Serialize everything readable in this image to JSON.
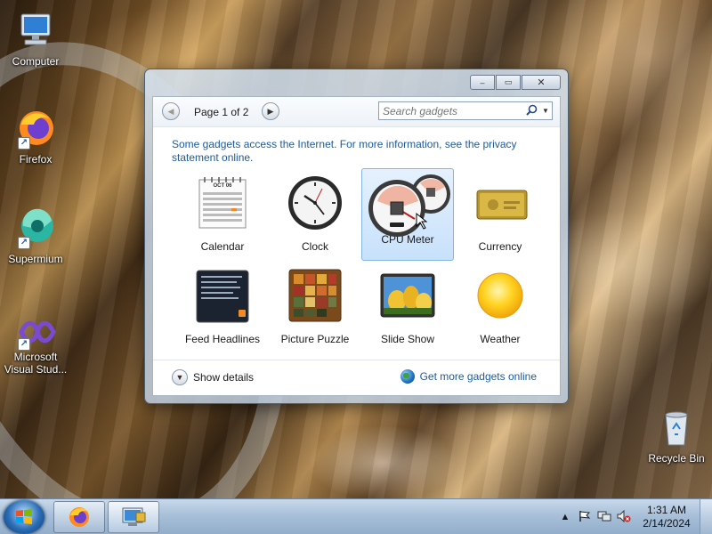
{
  "desktop": {
    "icons": [
      {
        "label": "Computer",
        "icon": "computer-icon"
      },
      {
        "label": "Firefox",
        "icon": "firefox-icon"
      },
      {
        "label": "Supermium",
        "icon": "supermium-icon"
      },
      {
        "label": "Microsoft Visual Stud...",
        "icon": "visual-studio-icon"
      },
      {
        "label": "Recycle Bin",
        "icon": "recycle-bin-icon"
      }
    ]
  },
  "gadget_window": {
    "controls": {
      "minimize": "‒",
      "restore": "▭",
      "close": "✕"
    },
    "nav": {
      "prev": "◀",
      "next": "▶",
      "page_label": "Page 1 of 2"
    },
    "search": {
      "placeholder": "Search gadgets",
      "icon": "search-icon",
      "dropdown": "▼"
    },
    "info_text": "Some gadgets access the Internet.  For more information, see the privacy statement online.",
    "gadgets": [
      {
        "name": "Calendar",
        "icon": "calendar-icon",
        "month": "OCT 06",
        "selected": false
      },
      {
        "name": "Clock",
        "icon": "clock-icon",
        "selected": false
      },
      {
        "name": "CPU Meter",
        "icon": "cpu-meter-icon",
        "selected": true
      },
      {
        "name": "Currency",
        "icon": "currency-icon",
        "selected": false
      },
      {
        "name": "Feed Headlines",
        "icon": "feed-headlines-icon",
        "selected": false
      },
      {
        "name": "Picture Puzzle",
        "icon": "picture-puzzle-icon",
        "selected": false
      },
      {
        "name": "Slide Show",
        "icon": "slide-show-icon",
        "selected": false
      },
      {
        "name": "Weather",
        "icon": "weather-icon",
        "selected": false
      }
    ],
    "footer": {
      "show_details": "Show details",
      "get_more": "Get more gadgets online"
    }
  },
  "taskbar": {
    "tray": {
      "arrow": "▲"
    },
    "clock": {
      "time": "1:31 AM",
      "date": "2/14/2024"
    }
  },
  "colors": {
    "link": "#1c5b9c",
    "selection": "#c7e1fb",
    "taskbar": "#a8c0d9"
  }
}
